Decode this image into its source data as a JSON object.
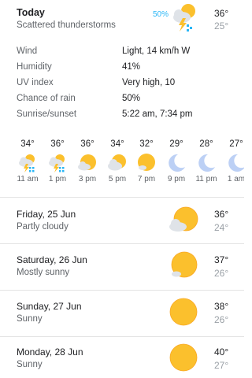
{
  "today": {
    "title": "Today",
    "condition": "Scattered thunderstorms",
    "rain_chance": "50%",
    "icon": "thunderstorm-icon",
    "high": "36°",
    "low": "25°"
  },
  "details": [
    {
      "label": "Wind",
      "value": "Light, 14 km/h W"
    },
    {
      "label": "Humidity",
      "value": "41%"
    },
    {
      "label": "UV index",
      "value": "Very high, 10"
    },
    {
      "label": "Chance of rain",
      "value": "50%"
    },
    {
      "label": "Sunrise/sunset",
      "value": "5:22 am, 7:34 pm"
    }
  ],
  "hourly": [
    {
      "temp": "34°",
      "time": "11 am",
      "icon": "thunderstorm-icon"
    },
    {
      "temp": "36°",
      "time": "1 pm",
      "icon": "thunderstorm-icon"
    },
    {
      "temp": "36°",
      "time": "3 pm",
      "icon": "partly-cloudy-icon"
    },
    {
      "temp": "34°",
      "time": "5 pm",
      "icon": "partly-cloudy-icon"
    },
    {
      "temp": "32°",
      "time": "7 pm",
      "icon": "sun-icon"
    },
    {
      "temp": "29°",
      "time": "9 pm",
      "icon": "moon-icon"
    },
    {
      "temp": "28°",
      "time": "11 pm",
      "icon": "moon-icon"
    },
    {
      "temp": "27°",
      "time": "1 am",
      "icon": "moon-icon"
    }
  ],
  "daily": [
    {
      "day": "Friday, 25 Jun",
      "condition": "Partly cloudy",
      "high": "36°",
      "low": "24°",
      "icon": "partly-cloudy-icon"
    },
    {
      "day": "Saturday, 26 Jun",
      "condition": "Mostly sunny",
      "high": "37°",
      "low": "26°",
      "icon": "mostly-sunny-icon"
    },
    {
      "day": "Sunday, 27 Jun",
      "condition": "Sunny",
      "high": "38°",
      "low": "26°",
      "icon": "sun-icon"
    },
    {
      "day": "Monday, 28 Jun",
      "condition": "Sunny",
      "high": "40°",
      "low": "27°",
      "icon": "sun-icon"
    }
  ],
  "colors": {
    "sun": "#fbc02d",
    "sun_edge": "#f9a825",
    "cloud": "#dfe3e8",
    "moon": "#bcd0f5",
    "rain": "#29b6f6",
    "divider": "#e3e3e3"
  }
}
